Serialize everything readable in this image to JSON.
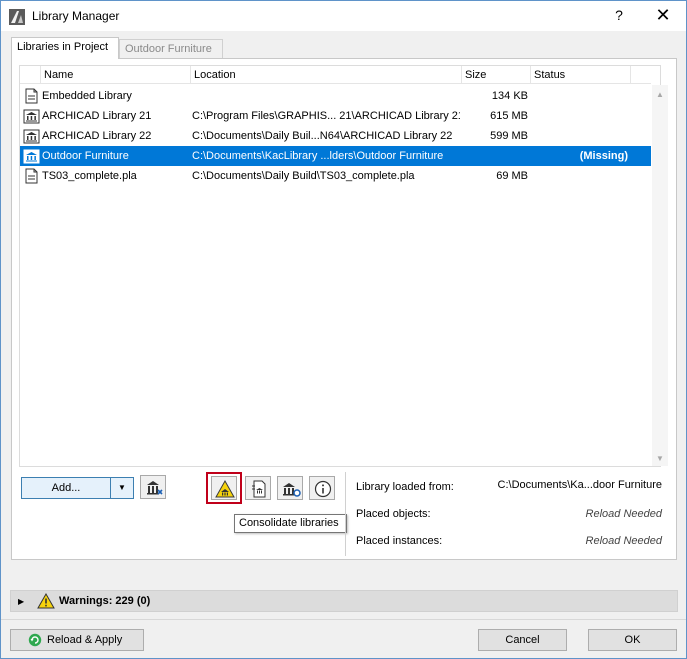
{
  "window": {
    "title": "Library Manager",
    "help": "?",
    "close": "✕"
  },
  "tabs": [
    {
      "label": "Libraries in Project"
    },
    {
      "label": "Outdoor Furniture"
    }
  ],
  "table": {
    "headers": {
      "name": "Name",
      "location": "Location",
      "size": "Size",
      "status": "Status"
    },
    "rows": [
      {
        "name": "Embedded Library",
        "location": "",
        "size": "134 KB",
        "status": ""
      },
      {
        "name": "ARCHICAD Library 21",
        "location": "C:\\Program Files\\GRAPHIS... 21\\ARCHICAD Library 21",
        "size": "615 MB",
        "status": ""
      },
      {
        "name": "ARCHICAD Library 22",
        "location": "C:\\Documents\\Daily Buil...N64\\ARCHICAD Library 22",
        "size": "599 MB",
        "status": ""
      },
      {
        "name": "Outdoor Furniture",
        "location": "C:\\Documents\\KacLibrary ...lders\\Outdoor Furniture",
        "size": "",
        "status": "(Missing)"
      },
      {
        "name": "TS03_complete.pla",
        "location": "C:\\Documents\\Daily Build\\TS03_complete.pla",
        "size": "69 MB",
        "status": ""
      }
    ],
    "selected_row": 3
  },
  "toolbar": {
    "add_label": "Add...",
    "add_arrow": "▼",
    "tooltip": "Consolidate libraries"
  },
  "info": {
    "loaded_from_label": "Library loaded from:",
    "loaded_from_value": "C:\\Documents\\Ka...door Furniture",
    "placed_objects_label": "Placed objects:",
    "placed_objects_value": "Reload Needed",
    "placed_instances_label": "Placed instances:",
    "placed_instances_value": "Reload Needed"
  },
  "warnings": {
    "text": "Warnings: 229 (0)",
    "toggle": "▶"
  },
  "footer": {
    "reload_label": "Reload & Apply",
    "cancel_label": "Cancel",
    "ok_label": "OK"
  },
  "colors": {
    "selection": "#0078d7",
    "highlight_box": "#c0001a",
    "warning_yellow": "#f6d30d"
  }
}
